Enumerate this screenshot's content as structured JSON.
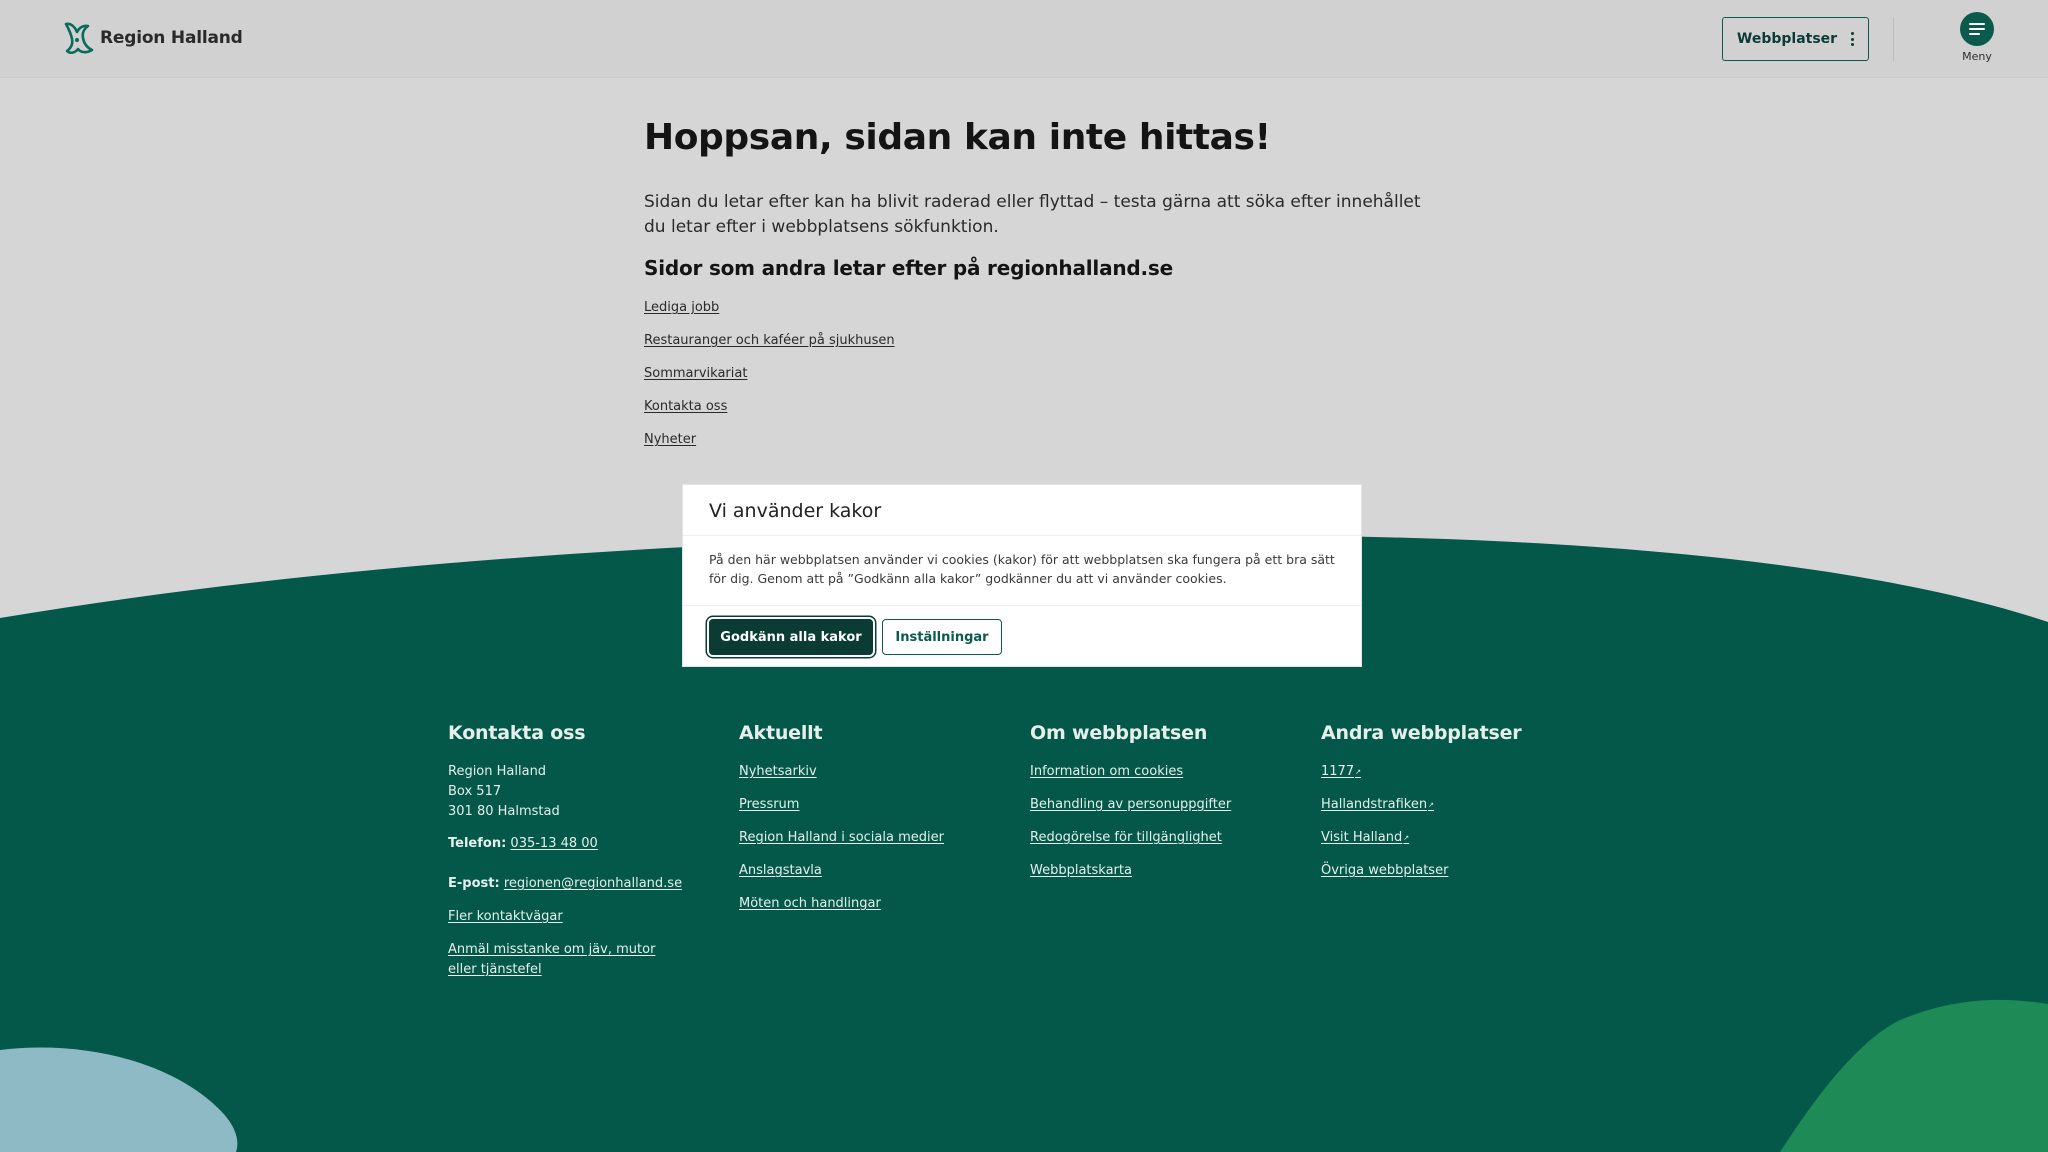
{
  "header": {
    "logo_text": "Region Halland",
    "sites_button_label": "Webbplatser",
    "menu_label": "Meny"
  },
  "main": {
    "title": "Hoppsan, sidan kan inte hittas!",
    "lead": "Sidan du letar efter kan ha blivit raderad eller flyttad – testa gärna att söka efter innehållet du letar efter i webbplatsens sökfunktion.",
    "popular_heading": "Sidor som andra letar efter på regionhalland.se",
    "popular_links": [
      "Lediga jobb",
      "Restauranger och kaféer på sjukhusen",
      "Sommarvikariat",
      "Kontakta oss",
      "Nyheter"
    ]
  },
  "cookie_dialog": {
    "title": "Vi använder kakor",
    "body": "På den här webbplatsen använder vi cookies (kakor) för att webbplatsen ska fungera på ett bra sätt för dig. Genom att på ”Godkänn alla kakor” godkänner du att vi använder cookies.",
    "accept_label": "Godkänn alla kakor",
    "settings_label": "Inställningar"
  },
  "footer": {
    "contact": {
      "heading": "Kontakta oss",
      "org": "Region Halland",
      "box": "Box 517",
      "city": "301 80 Halmstad",
      "phone_label": "Telefon:",
      "phone": "035-13 48 00",
      "email_label": "E-post:",
      "email": "regionen@regionhalland.se",
      "more_link": "Fler kontaktvägar",
      "report_link": "Anmäl misstanke om jäv, mutor eller tjänstefel"
    },
    "news": {
      "heading": "Aktuellt",
      "links": [
        "Nyhetsarkiv",
        "Pressrum",
        "Region Halland i sociala medier",
        "Anslagstavla",
        "Möten och handlingar"
      ]
    },
    "about": {
      "heading": "Om webbplatsen",
      "links": [
        "Information om cookies",
        "Behandling av personuppgifter",
        "Redogörelse för tillgänglighet",
        "Webbplatskarta"
      ]
    },
    "other": {
      "heading": "Andra webbplatser",
      "links": [
        "1177",
        "Hallandstrafiken",
        "Visit Halland",
        "Övriga webbplatser"
      ]
    }
  },
  "colors": {
    "brand_green": "#0b5a4c",
    "dark_green": "#0a3c34",
    "footer_bg": "#03584a",
    "light_blue_shape": "#8dbac4",
    "bright_green_shape": "#1e8a55"
  }
}
